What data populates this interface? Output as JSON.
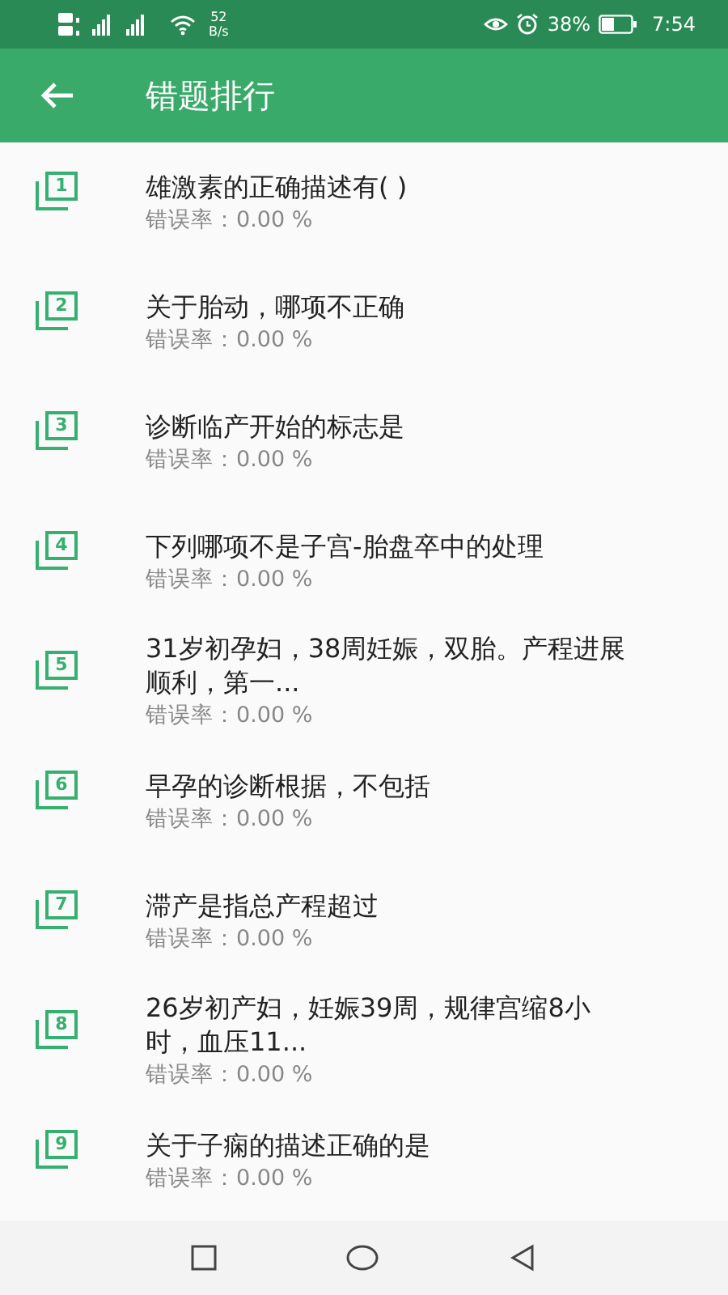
{
  "status_bar": {
    "speed": "52",
    "speed_unit": "B/s",
    "battery": "38%",
    "time": "7:54"
  },
  "app_bar": {
    "title": "错题排行"
  },
  "items": [
    {
      "rank": "1",
      "title": "雄激素的正确描述有( )",
      "rate": "错误率：0.00 %"
    },
    {
      "rank": "2",
      "title": "关于胎动，哪项不正确",
      "rate": "错误率：0.00 %"
    },
    {
      "rank": "3",
      "title": "诊断临产开始的标志是",
      "rate": "错误率：0.00 %"
    },
    {
      "rank": "4",
      "title": "下列哪项不是子宫-胎盘卒中的处理",
      "rate": "错误率：0.00 %"
    },
    {
      "rank": "5",
      "title": "31岁初孕妇，38周妊娠，双胎。产程进展顺利，第一...",
      "rate": "错误率：0.00 %"
    },
    {
      "rank": "6",
      "title": "早孕的诊断根据，不包括",
      "rate": "错误率：0.00 %"
    },
    {
      "rank": "7",
      "title": "滞产是指总产程超过",
      "rate": "错误率：0.00 %"
    },
    {
      "rank": "8",
      "title": "26岁初产妇，妊娠39周，规律宫缩8小时，血压11...",
      "rate": "错误率：0.00 %"
    },
    {
      "rank": "9",
      "title": "关于子痫的描述正确的是",
      "rate": "错误率：0.00 %"
    }
  ]
}
